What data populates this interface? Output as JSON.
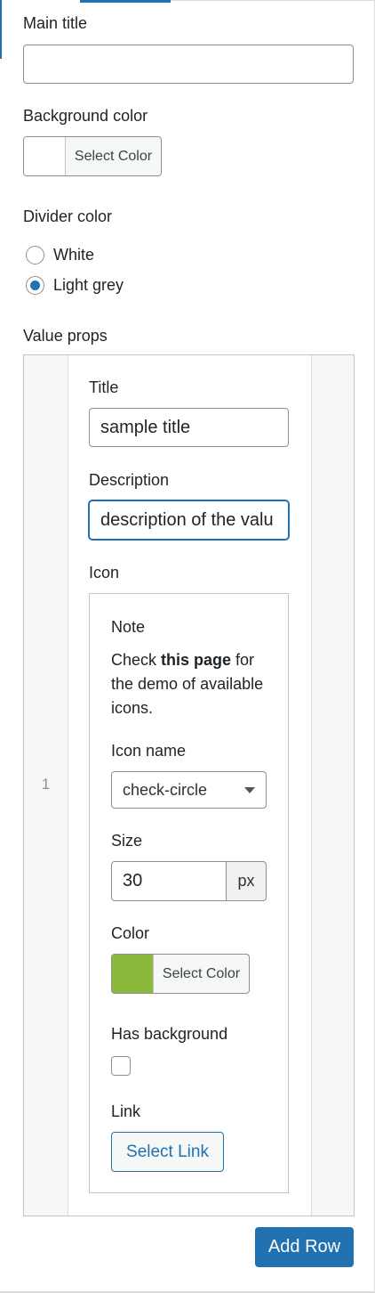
{
  "fields": {
    "main_title": {
      "label": "Main title",
      "value": ""
    },
    "background_color": {
      "label": "Background color",
      "button_label": "Select Color",
      "value": "#ffffff"
    },
    "divider_color": {
      "label": "Divider color",
      "options": [
        {
          "label": "White",
          "selected": false
        },
        {
          "label": "Light grey",
          "selected": true
        }
      ]
    },
    "value_props": {
      "label": "Value props"
    }
  },
  "rows": [
    {
      "index": "1",
      "title": {
        "label": "Title",
        "value": "sample title"
      },
      "description": {
        "label": "Description",
        "value": "description of the valu"
      },
      "icon": {
        "label": "Icon",
        "note": {
          "heading": "Note",
          "before": "Check ",
          "link": "this page",
          "after": " for the demo of available icons."
        },
        "icon_name": {
          "label": "Icon name",
          "value": "check-circle"
        },
        "size": {
          "label": "Size",
          "value": "30",
          "unit": "px"
        },
        "color": {
          "label": "Color",
          "button_label": "Select Color",
          "value": "#8ab83a"
        },
        "has_background": {
          "label": "Has background",
          "checked": false
        },
        "link": {
          "label": "Link",
          "button_label": "Select Link"
        }
      }
    }
  ],
  "actions": {
    "add_row": "Add Row"
  }
}
